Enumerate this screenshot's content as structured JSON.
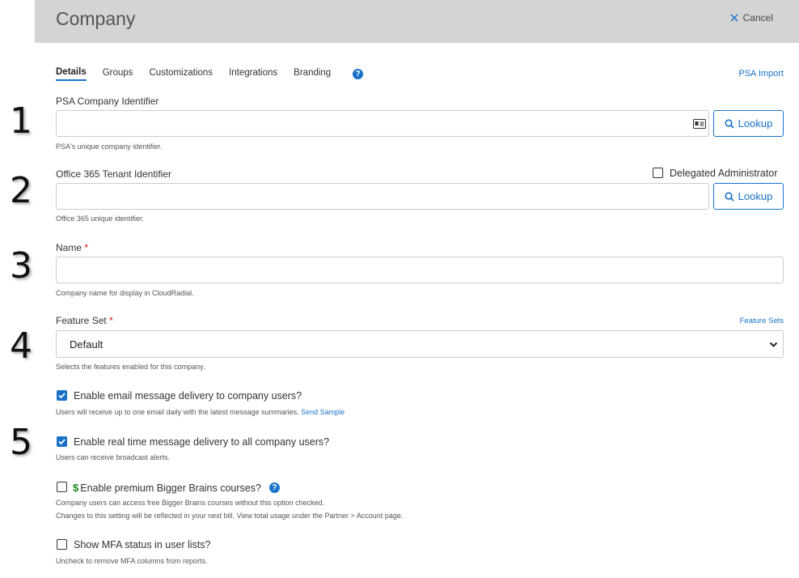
{
  "header": {
    "title": "Company",
    "cancel_label": "Cancel"
  },
  "tabs": [
    {
      "label": "Details"
    },
    {
      "label": "Groups"
    },
    {
      "label": "Customizations"
    },
    {
      "label": "Integrations"
    },
    {
      "label": "Branding"
    }
  ],
  "help_glyph": "?",
  "psa_import_link": "PSA Import",
  "step_numbers": [
    "1",
    "2",
    "3",
    "4",
    "5"
  ],
  "psa_identifier": {
    "label": "PSA Company Identifier",
    "value": "",
    "hint": "PSA's unique company identifier.",
    "lookup_label": "Lookup"
  },
  "o365_identifier": {
    "label": "Office 365 Tenant Identifier",
    "value": "",
    "hint": "Office 365 unique identifier.",
    "lookup_label": "Lookup",
    "delegated_label": "Delegated Administrator",
    "delegated_checked": false
  },
  "name_field": {
    "label": "Name",
    "required_mark": "*",
    "value": "",
    "hint": "Company name for display in CloudRadial."
  },
  "feature_set": {
    "label": "Feature Set",
    "required_mark": "*",
    "link": "Feature Sets",
    "selected": "Default",
    "hint": "Selects the features enabled for this company."
  },
  "options": {
    "email": {
      "label": "Enable email message delivery to company users?",
      "checked": true,
      "hint": "Users will receive up to one email daily with the latest message summaries.",
      "hint_link": "Send Sample"
    },
    "realtime": {
      "label": "Enable real time message delivery to all company users?",
      "checked": true,
      "hint": "Users can receive broadcast alerts."
    },
    "bigger_brains": {
      "label": "Enable premium Bigger Brains courses?",
      "dollar": "$",
      "checked": false,
      "hint1": "Company users can access free Bigger Brains courses without this option checked.",
      "hint2": "Changes to this setting will be reflected in your next bill. View total usage under the Partner > Account page."
    },
    "mfa": {
      "label": "Show MFA status in user lists?",
      "checked": false,
      "hint": "Uncheck to remove MFA columns from reports."
    }
  },
  "colors": {
    "accent": "#1a73c8",
    "header_bg": "#d4d4d4",
    "required": "#d11111",
    "dollar": "#1a8a1a"
  }
}
